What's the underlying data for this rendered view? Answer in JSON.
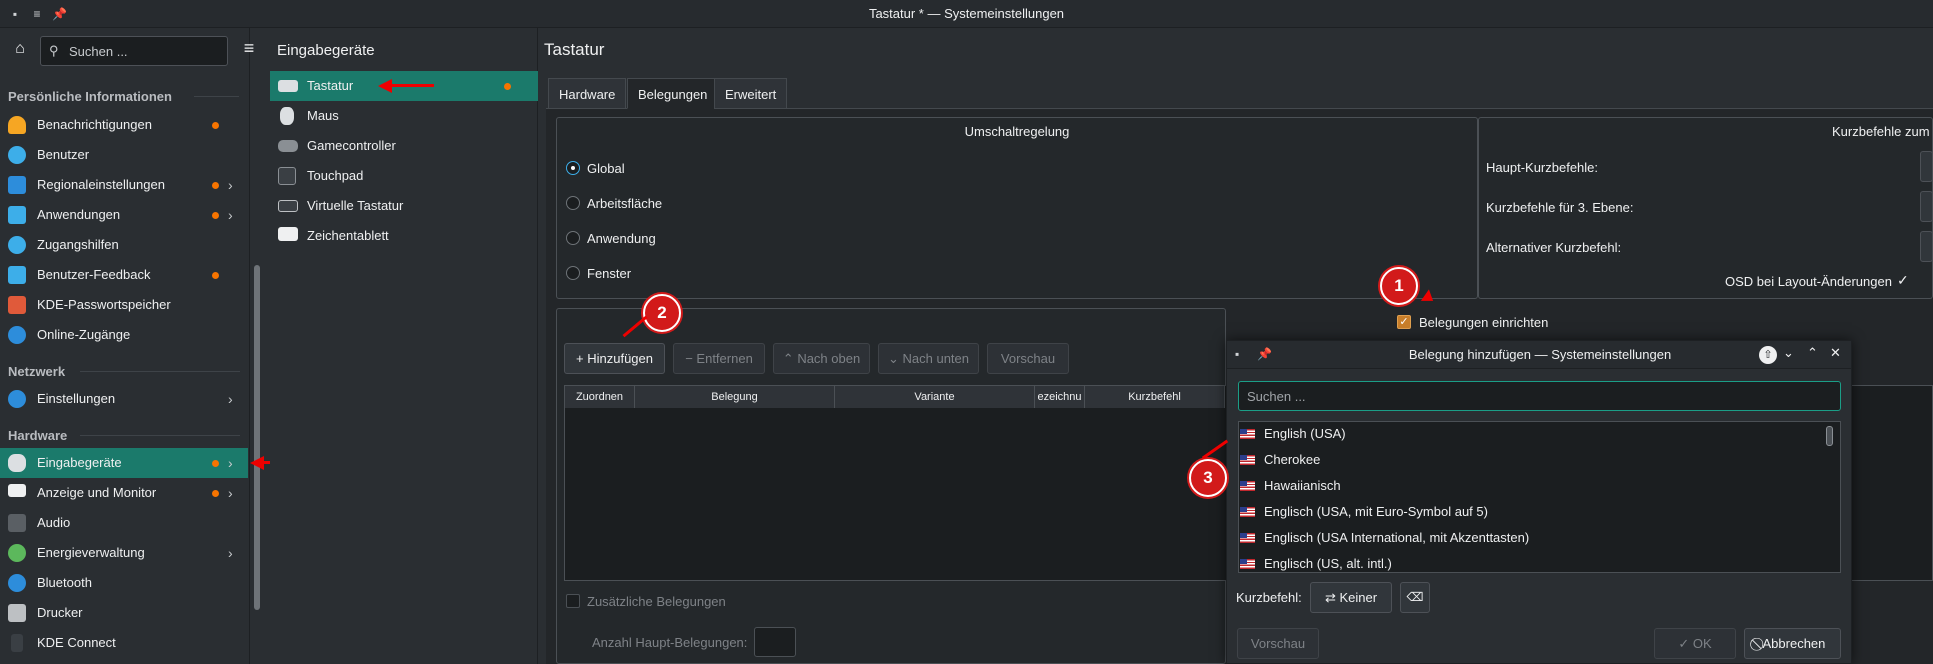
{
  "window": {
    "title": "Tastatur * — Systemeinstellungen"
  },
  "sidebar": {
    "search_placeholder": "Suchen ...",
    "sections": {
      "personal": "Persönliche Informationen",
      "network": "Netzwerk",
      "hardware": "Hardware"
    },
    "items": {
      "notifications": "Benachrichtigungen",
      "users": "Benutzer",
      "regional": "Regionaleinstellungen",
      "apps": "Anwendungen",
      "accessibility": "Zugangshilfen",
      "feedback": "Benutzer-Feedback",
      "wallet": "KDE-Passwortspeicher",
      "online": "Online-Zugänge",
      "net_settings": "Einstellungen",
      "input": "Eingabegeräte",
      "display": "Anzeige und Monitor",
      "audio": "Audio",
      "power": "Energieverwaltung",
      "bluetooth": "Bluetooth",
      "printers": "Drucker",
      "kdeconnect": "KDE Connect"
    }
  },
  "subnav": {
    "title": "Eingabegeräte",
    "items": {
      "keyboard": "Tastatur",
      "mouse": "Maus",
      "gamecontroller": "Gamecontroller",
      "touchpad": "Touchpad",
      "virtual": "Virtuelle Tastatur",
      "tablet": "Zeichentablett"
    }
  },
  "main": {
    "title": "Tastatur",
    "tabs": {
      "hardware": "Hardware",
      "layouts": "Belegungen",
      "advanced": "Erweitert"
    },
    "switching": {
      "title": "Umschaltregelung",
      "options": {
        "global": "Global",
        "desktop": "Arbeitsfläche",
        "app": "Anwendung",
        "window": "Fenster"
      }
    },
    "shortcuts": {
      "title": "Kurzbefehle zum L",
      "main": "Haupt-Kurzbefehle:",
      "third": "Kurzbefehle für 3. Ebene:",
      "alt": "Alternativer Kurzbefehl:",
      "osd": "OSD bei Layout-Änderungen"
    },
    "configure_layouts": "Belegungen einrichten",
    "buttons": {
      "add": "Hinzufügen",
      "remove": "Entfernen",
      "up": "Nach oben",
      "down": "Nach unten",
      "preview": "Vorschau"
    },
    "table_headers": {
      "map": "Zuordnen",
      "layout": "Belegung",
      "variant": "Variante",
      "label": "ezeichnu",
      "shortcut": "Kurzbefehl"
    },
    "extra_layouts": "Zusätzliche Belegungen",
    "main_count": "Anzahl Haupt-Belegungen:"
  },
  "dialog": {
    "title": "Belegung hinzufügen — Systemeinstellungen",
    "search_placeholder": "Suchen ...",
    "rows": [
      "English (USA)",
      "Cherokee",
      "Hawaiianisch",
      "Englisch (USA, mit Euro-Symbol auf 5)",
      "Englisch (USA International, mit Akzenttasten)",
      "Englisch (US, alt. intl.)"
    ],
    "shortcut_label": "Kurzbefehl:",
    "shortcut_value": "Keiner",
    "preview": "Vorschau",
    "ok": "OK",
    "cancel": "Abbrechen"
  },
  "markers": {
    "m1": "1",
    "m2": "2",
    "m3": "3"
  },
  "colors": {
    "accent": "#1b7a6b",
    "marker": "#d21a1a",
    "notify_dot": "#f67400"
  }
}
